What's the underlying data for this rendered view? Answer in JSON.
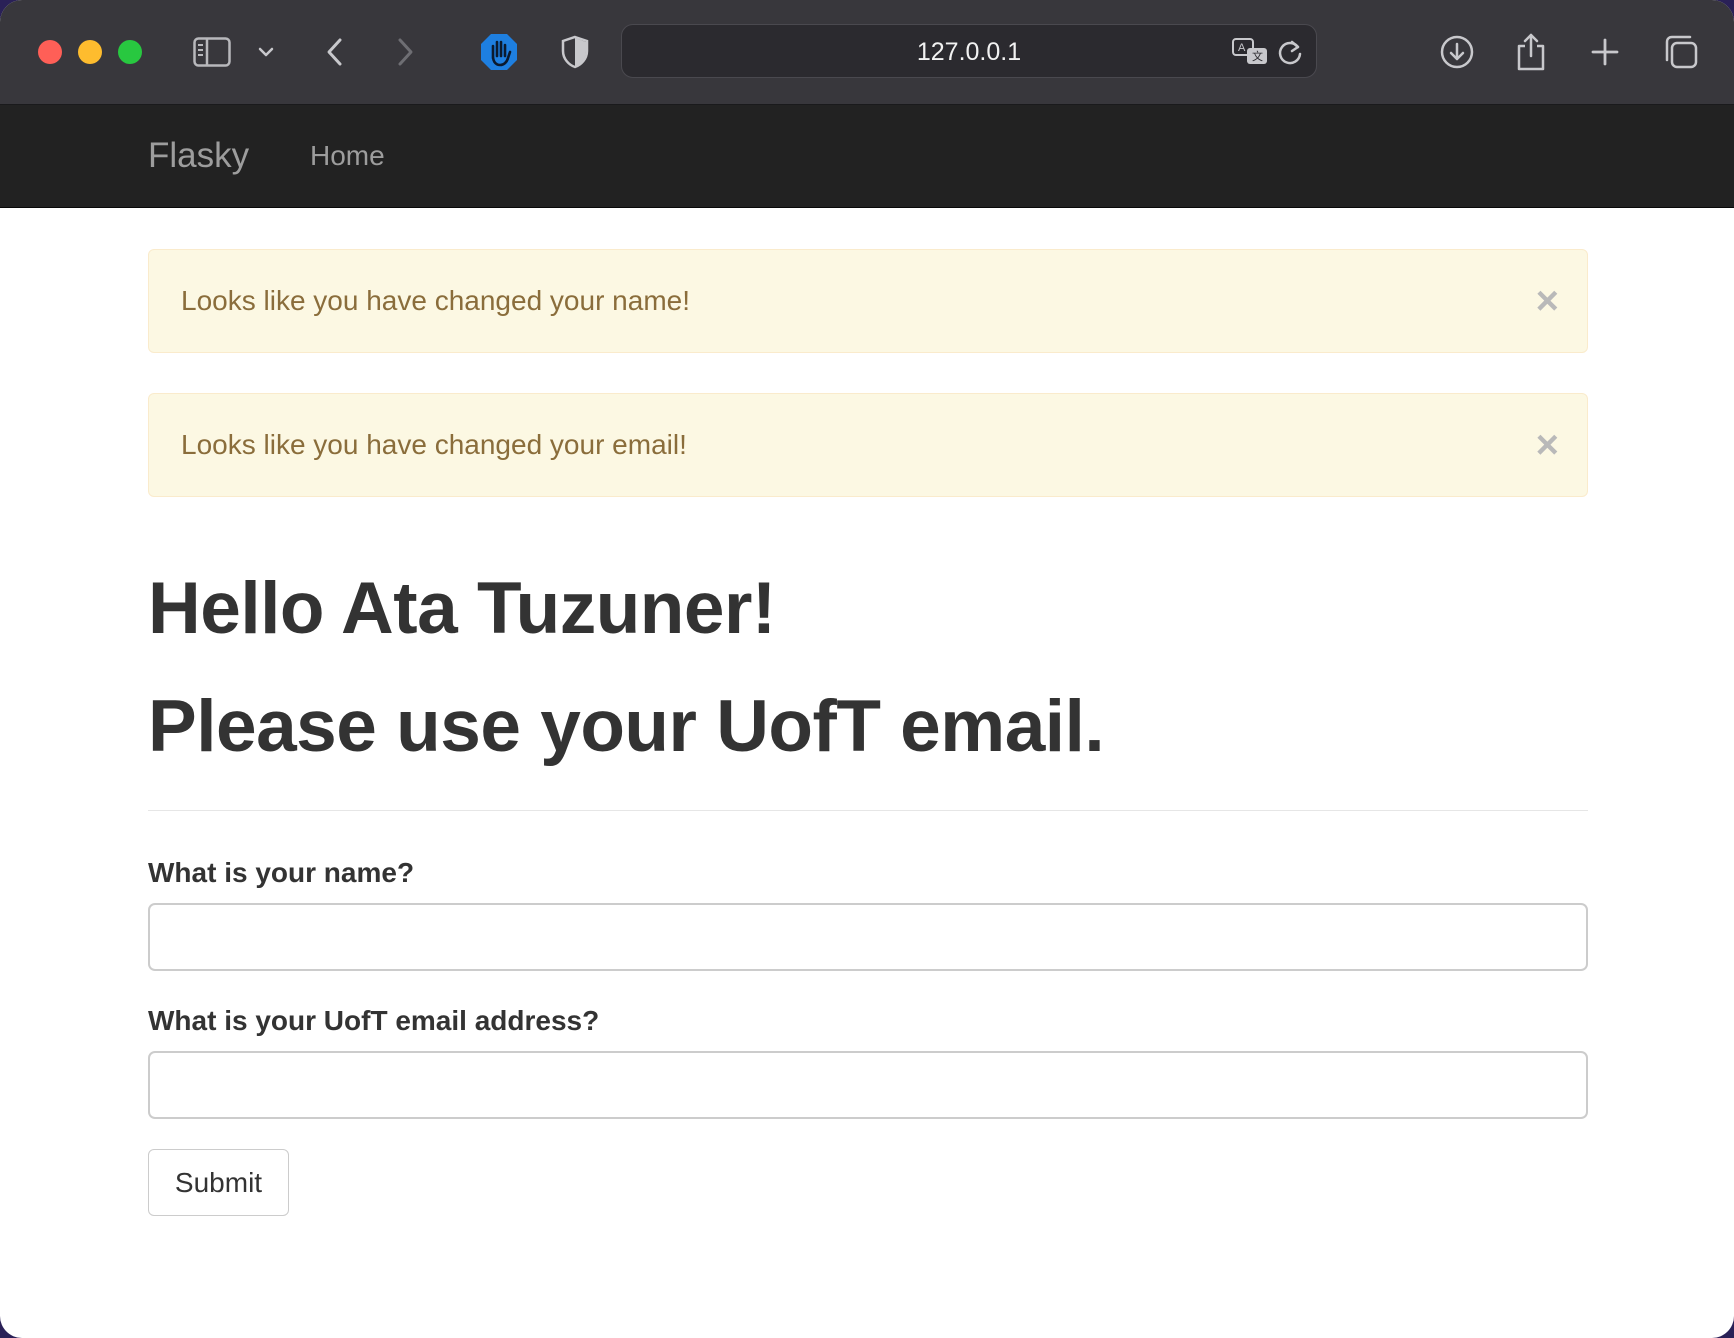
{
  "browser": {
    "url": "127.0.0.1",
    "icons": [
      "sidebar-icon",
      "chevron-down-icon",
      "back-icon",
      "forward-icon",
      "hand-block-icon",
      "shield-icon",
      "translate-icon",
      "reload-icon",
      "download-icon",
      "share-icon",
      "new-tab-icon",
      "tabs-overview-icon"
    ]
  },
  "navbar": {
    "brand": "Flasky",
    "links": [
      {
        "label": "Home"
      }
    ]
  },
  "alerts": [
    {
      "message": "Looks like you have changed your name!",
      "close": "×"
    },
    {
      "message": "Looks like you have changed your email!",
      "close": "×"
    }
  ],
  "page": {
    "greeting": "Hello Ata Tuzuner!",
    "subheading": "Please use your UofT email."
  },
  "form": {
    "name_label": "What is your name?",
    "name_value": "",
    "email_label": "What is your UofT email address?",
    "email_value": "",
    "submit_label": "Submit"
  },
  "colors": {
    "navbar_bg": "#222222",
    "alert_bg": "#fcf8e3",
    "alert_text": "#8a6d3b",
    "accent_blue": "#1e7fe0"
  }
}
